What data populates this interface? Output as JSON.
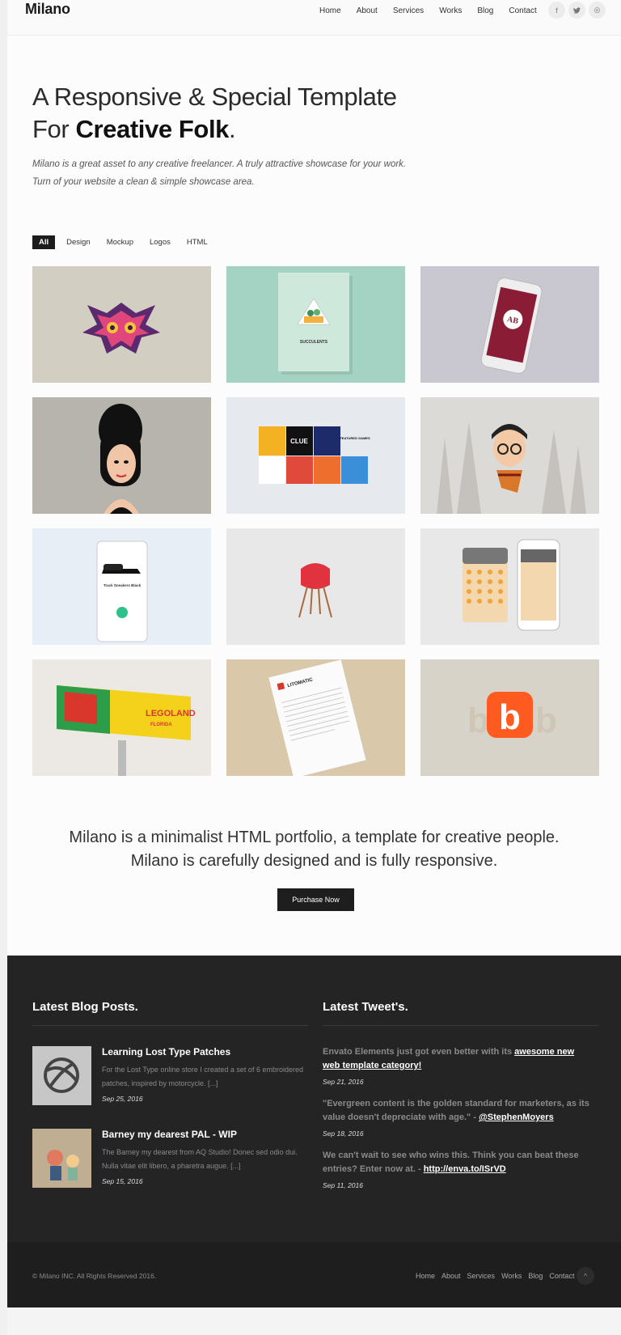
{
  "header": {
    "logo": "Milano",
    "nav": [
      "Home",
      "About",
      "Services",
      "Works",
      "Blog",
      "Contact"
    ],
    "social": [
      {
        "icon": "facebook-icon",
        "glyph": "f"
      },
      {
        "icon": "twitter-icon",
        "glyph": "t"
      },
      {
        "icon": "dribbble-icon",
        "glyph": "◎"
      }
    ]
  },
  "hero": {
    "line1": "A Responsive & Special Template",
    "line2_prefix": "For ",
    "line2_bold": "Creative Folk",
    "line2_suffix": ".",
    "sub1": "Milano is a great asset to any creative freelancer. A truly attractive showcase for your work.",
    "sub2": "Turn of your website a clean & simple showcase area."
  },
  "filters": [
    "All",
    "Design",
    "Mockup",
    "Logos",
    "HTML"
  ],
  "about": {
    "line1": "Milano is a minimalist HTML portfolio, a template for creative people.",
    "line2": "Milano is carefully designed and is fully responsive.",
    "cta": "Purchase Now"
  },
  "blog": {
    "heading": "Latest Blog Posts.",
    "posts": [
      {
        "title": "Learning Lost Type Patches",
        "excerpt": "For the Lost Type online store I created a set of 6 embroidered patches, inspired by motorcycle. [...]",
        "date": "Sep 25, 2016"
      },
      {
        "title": "Barney my dearest PAL - WIP",
        "excerpt": "The Barney my dearest from AQ Studio! Donec sed odio dui. Nulla vitae elit libero, a pharetra augue. [...]",
        "date": "Sep 15, 2016"
      }
    ]
  },
  "tweets": {
    "heading": "Latest Tweet's.",
    "items": [
      {
        "text": "Envato Elements just got even better with its ",
        "link": "awesome new web template category!",
        "date": "Sep 21, 2016"
      },
      {
        "text": "\"Evergreen content is the golden standard for marketers, as its value doesn't depreciate with age.\" - ",
        "link": "@StephenMoyers",
        "date": "Sep 18, 2016"
      },
      {
        "text": "We can't wait to see who wins this. Think you can beat these entries? Enter now at. - ",
        "link": "http://enva.to/ISrVD",
        "date": "Sep 11, 2016"
      }
    ]
  },
  "footer": {
    "copyright": "© Milano INC. All Rights Reserved 2016.",
    "nav": [
      "Home",
      "About",
      "Services",
      "Works",
      "Blog",
      "Contact"
    ],
    "totop": "^"
  },
  "portfolio_text": {
    "succulents": "SUCCULENTS",
    "ab": "AB",
    "clue": "CLUE",
    "featured": "FEATURED GAMES",
    "sneaker": "Track Sneakers Black",
    "legoland": "LEGOLAND",
    "florida": "FLORIDA",
    "litomatic": "LITOMATIC",
    "b": "b"
  },
  "colors": {
    "dark": "#242424",
    "darker": "#1e1e1e",
    "accent_orange": "#ff5a1f"
  }
}
